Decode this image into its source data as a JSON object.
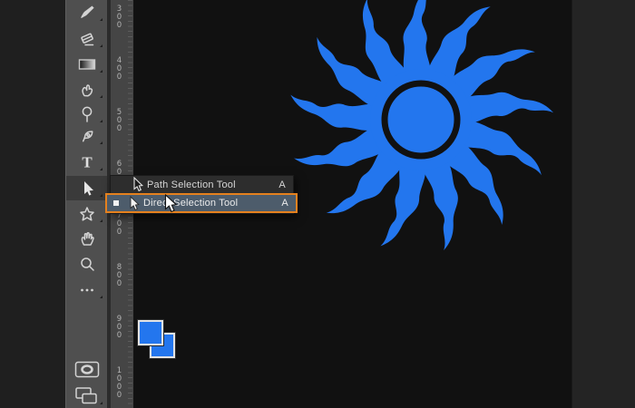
{
  "app": {
    "name": "photoshop-workspace"
  },
  "colors": {
    "accent_blue": "#2376ee",
    "canvas_bg": "#111111",
    "pasteboard_bg": "#242424",
    "left_panel_bg": "#1f1f1f",
    "toolbar_bg": "#4f4f4f",
    "ruler_bg": "#454545",
    "menu_bg": "#2d2d2d",
    "menu_highlight_bg": "#4d5c6b",
    "menu_highlight_border": "#e5811e",
    "menu_text": "#d6d6d6"
  },
  "toolbar": {
    "tools": [
      {
        "id": "brush",
        "icon": "brush-icon"
      },
      {
        "id": "eraser",
        "icon": "eraser-icon"
      },
      {
        "id": "gradient",
        "icon": "gradient-icon"
      },
      {
        "id": "smudge",
        "icon": "smudge-finger-icon"
      },
      {
        "id": "dodge",
        "icon": "dodge-icon"
      },
      {
        "id": "pen",
        "icon": "pen-nib-icon"
      },
      {
        "id": "type",
        "icon": "type-T-icon",
        "glyph": "T"
      },
      {
        "id": "path-selection",
        "icon": "black-arrow-icon",
        "active": true
      },
      {
        "id": "custom-shape",
        "icon": "star-shape-icon"
      },
      {
        "id": "hand",
        "icon": "hand-icon"
      },
      {
        "id": "zoom",
        "icon": "magnifier-icon"
      },
      {
        "id": "edit-toolbar",
        "icon": "ellipsis-icon"
      },
      {
        "id": "default-swatches",
        "icon": "mini-swatches-icon"
      },
      {
        "id": "swap-swatches",
        "icon": "swap-arrows-icon"
      },
      {
        "id": "foreground-color",
        "icon": "foreground-swatch"
      },
      {
        "id": "background-color",
        "icon": "background-swatch"
      },
      {
        "id": "quick-mask",
        "icon": "quick-mask-icon"
      },
      {
        "id": "screen-mode",
        "icon": "screen-mode-icon"
      }
    ]
  },
  "ruler": {
    "orientation": "vertical",
    "labels": [
      "300",
      "400",
      "500",
      "600",
      "700",
      "800",
      "900",
      "1000"
    ]
  },
  "flyout_menu": {
    "items": [
      {
        "label": "Path Selection Tool",
        "shortcut": "A",
        "selected": false,
        "icon": "path-selection-arrow-icon"
      },
      {
        "label": "Direct Selection Tool",
        "shortcut": "A",
        "selected": true,
        "icon": "direct-selection-arrow-icon"
      }
    ]
  },
  "canvas": {
    "shape": "sun-shape",
    "ray_count": 13
  }
}
